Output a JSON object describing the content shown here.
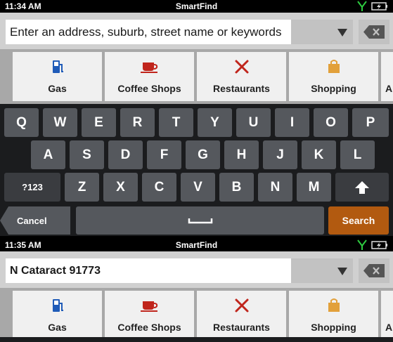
{
  "screens": [
    {
      "status": {
        "time": "11:34 AM",
        "app_title": "SmartFind"
      },
      "search": {
        "placeholder": "Enter an address, suburb, street name or keywords",
        "value": ""
      }
    },
    {
      "status": {
        "time": "11:35 AM",
        "app_title": "SmartFind"
      },
      "search": {
        "placeholder": "",
        "value": "N Cataract 91773"
      }
    }
  ],
  "categories": [
    {
      "label": "Gas",
      "icon": "gas-pump-icon",
      "color": "#1f5bb8"
    },
    {
      "label": "Coffee Shops",
      "icon": "coffee-cup-icon",
      "color": "#c0251c"
    },
    {
      "label": "Restaurants",
      "icon": "fork-knife-icon",
      "color": "#c0251c"
    },
    {
      "label": "Shopping",
      "icon": "shopping-bag-icon",
      "color": "#e2a03a"
    },
    {
      "label": "A"
    }
  ],
  "keyboard": {
    "row1": [
      "Q",
      "W",
      "E",
      "R",
      "T",
      "Y",
      "U",
      "I",
      "O",
      "P"
    ],
    "row2": [
      "A",
      "S",
      "D",
      "F",
      "G",
      "H",
      "J",
      "K",
      "L"
    ],
    "row3": [
      "Z",
      "X",
      "C",
      "V",
      "B",
      "N",
      "M"
    ],
    "symbols_key": "?123",
    "shift_icon": "shift-arrow-icon",
    "cancel_label": "Cancel",
    "space_icon": "space-bar-icon",
    "search_label": "Search"
  },
  "colors": {
    "search_key": "#b25a10",
    "key": "#55585d",
    "keyboard_bg": "#1b1c1e",
    "signal": "#2ecc40"
  }
}
